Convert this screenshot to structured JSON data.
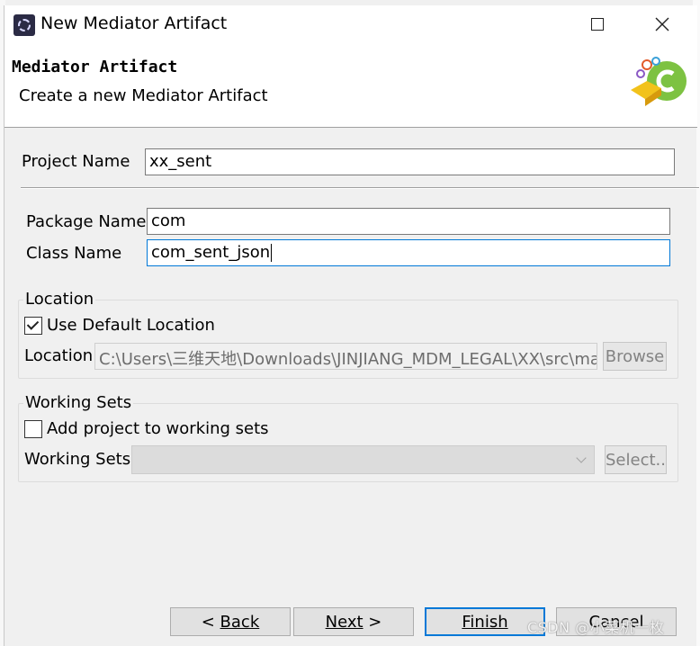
{
  "window": {
    "title": "New Mediator Artifact",
    "maximize_icon": "maximize-icon",
    "close_icon": "close-icon"
  },
  "banner": {
    "title": "Mediator Artifact",
    "description": "Create a new Mediator Artifact",
    "icon": "wizard-graphic-icon"
  },
  "form": {
    "project_name_label": "Project Name",
    "project_name_value": "xx_sent",
    "package_name_label": "Package Name",
    "package_name_value": "com",
    "class_name_label": "Class Name",
    "class_name_value": "com_sent_json"
  },
  "location_group": {
    "title": "Location",
    "use_default_label": "Use Default Location",
    "use_default_checked": true,
    "location_label": "Location",
    "location_value": "C:\\Users\\三维天地\\Downloads\\JINJIANG_MDM_LEGAL\\XX\\src\\ma",
    "browse_label": "Browse"
  },
  "working_sets_group": {
    "title": "Working Sets",
    "add_label": "Add project to working sets",
    "add_checked": false,
    "working_sets_label": "Working Sets",
    "working_sets_value": "",
    "select_label": "Select.."
  },
  "buttons": {
    "back_prefix": "< ",
    "back_label": "Back",
    "next_label": "Next",
    "next_suffix": " >",
    "finish_label": "Finish",
    "cancel_label": "Cancel"
  },
  "watermark": "CSDN @小菜机一枚",
  "colors": {
    "focus_border": "#0078d7",
    "dialog_bg": "#f0f0f0"
  }
}
